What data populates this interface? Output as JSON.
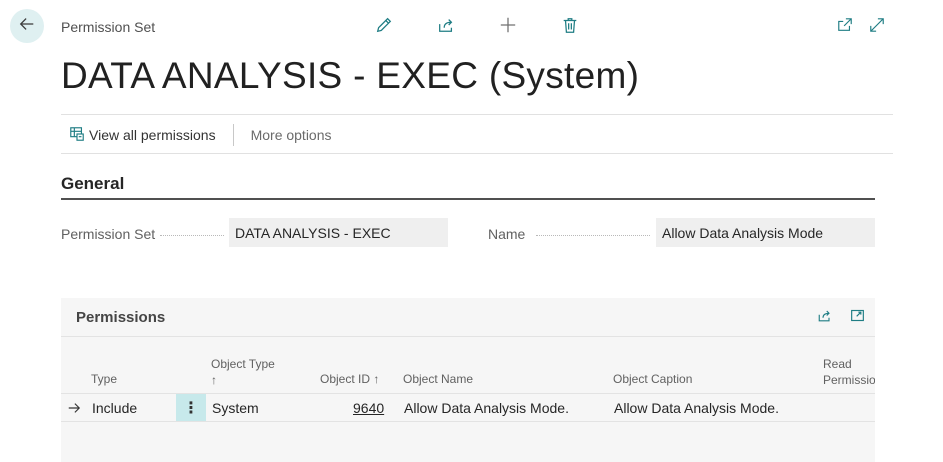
{
  "header": {
    "entity_label": "Permission Set",
    "title": "DATA ANALYSIS - EXEC (System)"
  },
  "icons": {
    "back": "arrow-left-icon",
    "edit": "pencil-icon",
    "share": "share-icon",
    "new": "plus-icon",
    "delete": "trash-icon",
    "open_new_window": "open-new-window-icon",
    "expand": "expand-icon"
  },
  "action_bar": {
    "view_all_permissions": "View all permissions",
    "more_options": "More options"
  },
  "general": {
    "section_title": "General",
    "permission_set_label": "Permission Set",
    "permission_set_value": "DATA ANALYSIS - EXEC",
    "name_label": "Name",
    "name_value": "Allow Data Analysis Mode"
  },
  "permissions": {
    "title": "Permissions",
    "columns": {
      "type": "Type",
      "object_type": "Object Type",
      "object_type_sort": "↑",
      "object_id": "Object ID ↑",
      "object_name": "Object Name",
      "object_caption": "Object Caption",
      "read_line1": "Read",
      "read_line2": "Permission"
    },
    "rows": [
      {
        "type": "Include",
        "menu": "⋮",
        "object_type": "System",
        "object_id": "9640",
        "object_name": "Allow Data Analysis Mode.",
        "object_caption": "Allow Data Analysis Mode."
      }
    ]
  },
  "colors": {
    "accent": "#008489",
    "back_button_bg": "#dff0f1",
    "row_menu_bg": "#c7e9eb",
    "field_bg": "#efefef",
    "part_bg": "#f6f6f6"
  }
}
